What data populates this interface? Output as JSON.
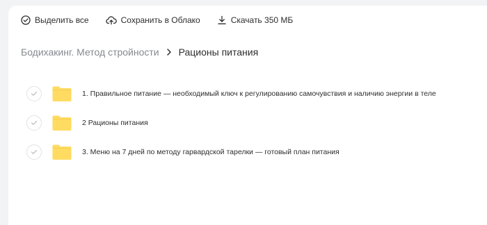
{
  "toolbar": {
    "select_all_label": "Выделить все",
    "save_cloud_label": "Сохранить в Облако",
    "download_label": "Скачать 350 МБ"
  },
  "breadcrumb": {
    "parent": "Бодихакинг. Метод стройности",
    "current": "Рационы питания"
  },
  "files": [
    {
      "name": "1. Правильное питание — необходимый ключ к регулированию самочувствия и наличию энергии в теле",
      "type": "folder"
    },
    {
      "name": "2 Рационы питания",
      "type": "folder"
    },
    {
      "name": "3. Меню на 7 дней по методу гарвардской тарелки — готовый план питания",
      "type": "folder"
    }
  ],
  "colors": {
    "background": "#f2f3f5",
    "panel": "#ffffff",
    "folder": "#ffdb61",
    "text": "#2c2d2e",
    "muted": "#87898f"
  },
  "icons": {
    "select_all": "check-circle-icon",
    "save_cloud": "cloud-upload-icon",
    "download": "download-icon",
    "separator": "chevron-right-icon",
    "folder": "folder-icon"
  }
}
